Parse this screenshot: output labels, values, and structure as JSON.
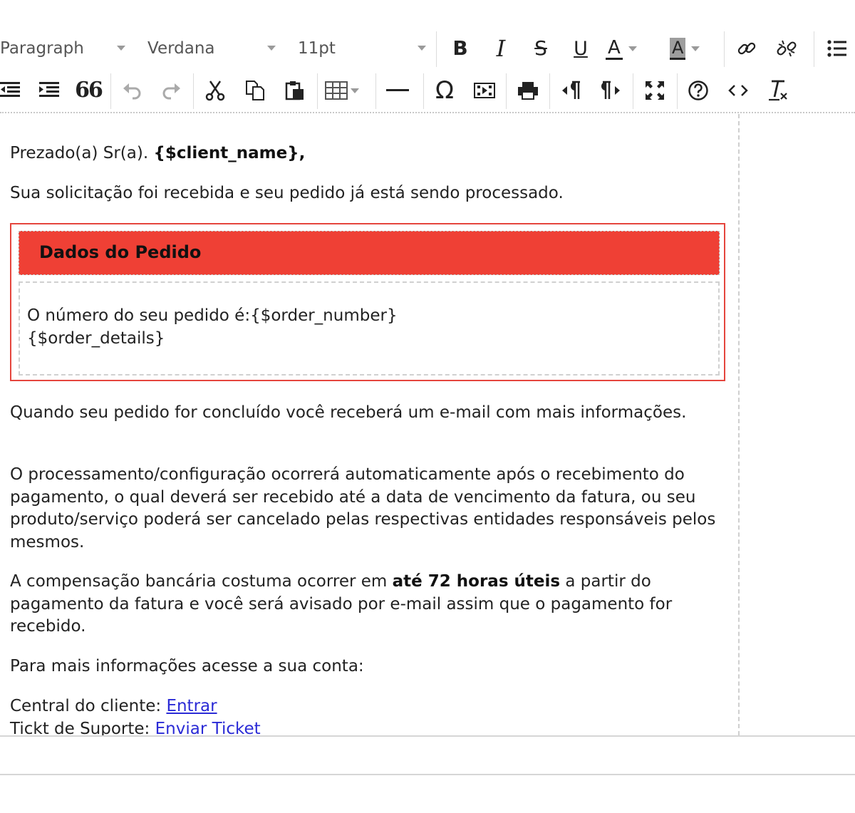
{
  "toolbar": {
    "format_select": "Paragraph",
    "font_select": "Verdana",
    "size_select": "11pt",
    "bold_label": "B",
    "italic_label": "I",
    "strike_label": "S",
    "underline_label": "U",
    "forecolor_label": "A",
    "backcolor_label": "A",
    "quote_label": "66",
    "omega_label": "Ω",
    "icons": [
      "bold-icon",
      "italic-icon",
      "strikethrough-icon",
      "underline-icon",
      "text-color-icon",
      "background-color-icon",
      "link-icon",
      "unlink-icon",
      "bullet-list-icon",
      "outdent-icon",
      "indent-icon",
      "blockquote-icon",
      "undo-icon",
      "redo-icon",
      "cut-icon",
      "copy-icon",
      "paste-icon",
      "table-icon",
      "horizontal-rule-icon",
      "special-char-icon",
      "media-icon",
      "print-icon",
      "ltr-icon",
      "rtl-icon",
      "fullscreen-icon",
      "help-icon",
      "source-code-icon",
      "clear-format-icon"
    ]
  },
  "email": {
    "greeting_prefix": "Prezado(a) Sr(a).",
    "greeting_var": "{$client_name},",
    "received": "Sua solicitação foi recebida e seu pedido já está sendo processado.",
    "order_title": "Dados do Pedido",
    "order_number_line": "O número do seu pedido é:{$order_number}",
    "order_details_line": "{$order_details}",
    "completed": "Quando seu pedido for concluído você receberá um e-mail com mais informações.",
    "processing": "O processamento/configuração ocorrerá automaticamente após o recebimento do pagamento, o qual deverá ser recebido até a data de vencimento da fatura, ou seu produto/serviço poderá ser cancelado pelas respectivas entidades responsáveis pelos mesmos.",
    "compensation_prefix": "A compensação bancária costuma ocorrer em",
    "compensation_bold": "até 72 horas úteis",
    "compensation_suffix": "a partir do pagamento da fatura e você será avisado por e-mail assim que o pagamento for recebido.",
    "more_info": "Para mais informações acesse a sua conta:",
    "client_center_label": "Central do cliente:",
    "client_center_link": "Entrar",
    "ticket_label": "Tickt de Suporte:",
    "ticket_link": "Enviar Ticket"
  },
  "colors": {
    "accent_red": "#ef4035",
    "link_blue": "#2b2bd6"
  }
}
